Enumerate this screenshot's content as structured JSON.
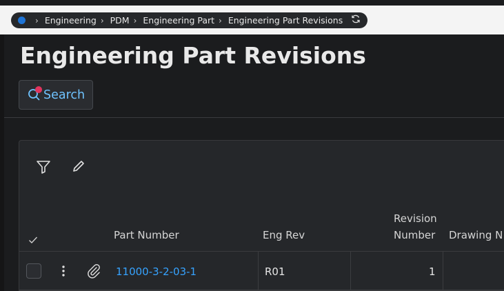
{
  "breadcrumb": {
    "items": [
      "Engineering",
      "PDM",
      "Engineering Part",
      "Engineering Part Revisions"
    ]
  },
  "page": {
    "title": "Engineering Part Revisions"
  },
  "search": {
    "label": "Search"
  },
  "table": {
    "columns": {
      "part_number": "Part Number",
      "eng_rev": "Eng Rev",
      "revision_number_line1": "Revision",
      "revision_number_line2": "Number",
      "drawing_no": "Drawing N"
    },
    "rows": [
      {
        "part_number": "11000-3-2-03-1",
        "eng_rev": "R01",
        "revision_number": "1",
        "drawing_no": ""
      }
    ]
  },
  "colors": {
    "accent": "#36a3ff",
    "search_text": "#6fc3ff",
    "badge": "#e0345e",
    "home_dot": "#1e74d6"
  }
}
